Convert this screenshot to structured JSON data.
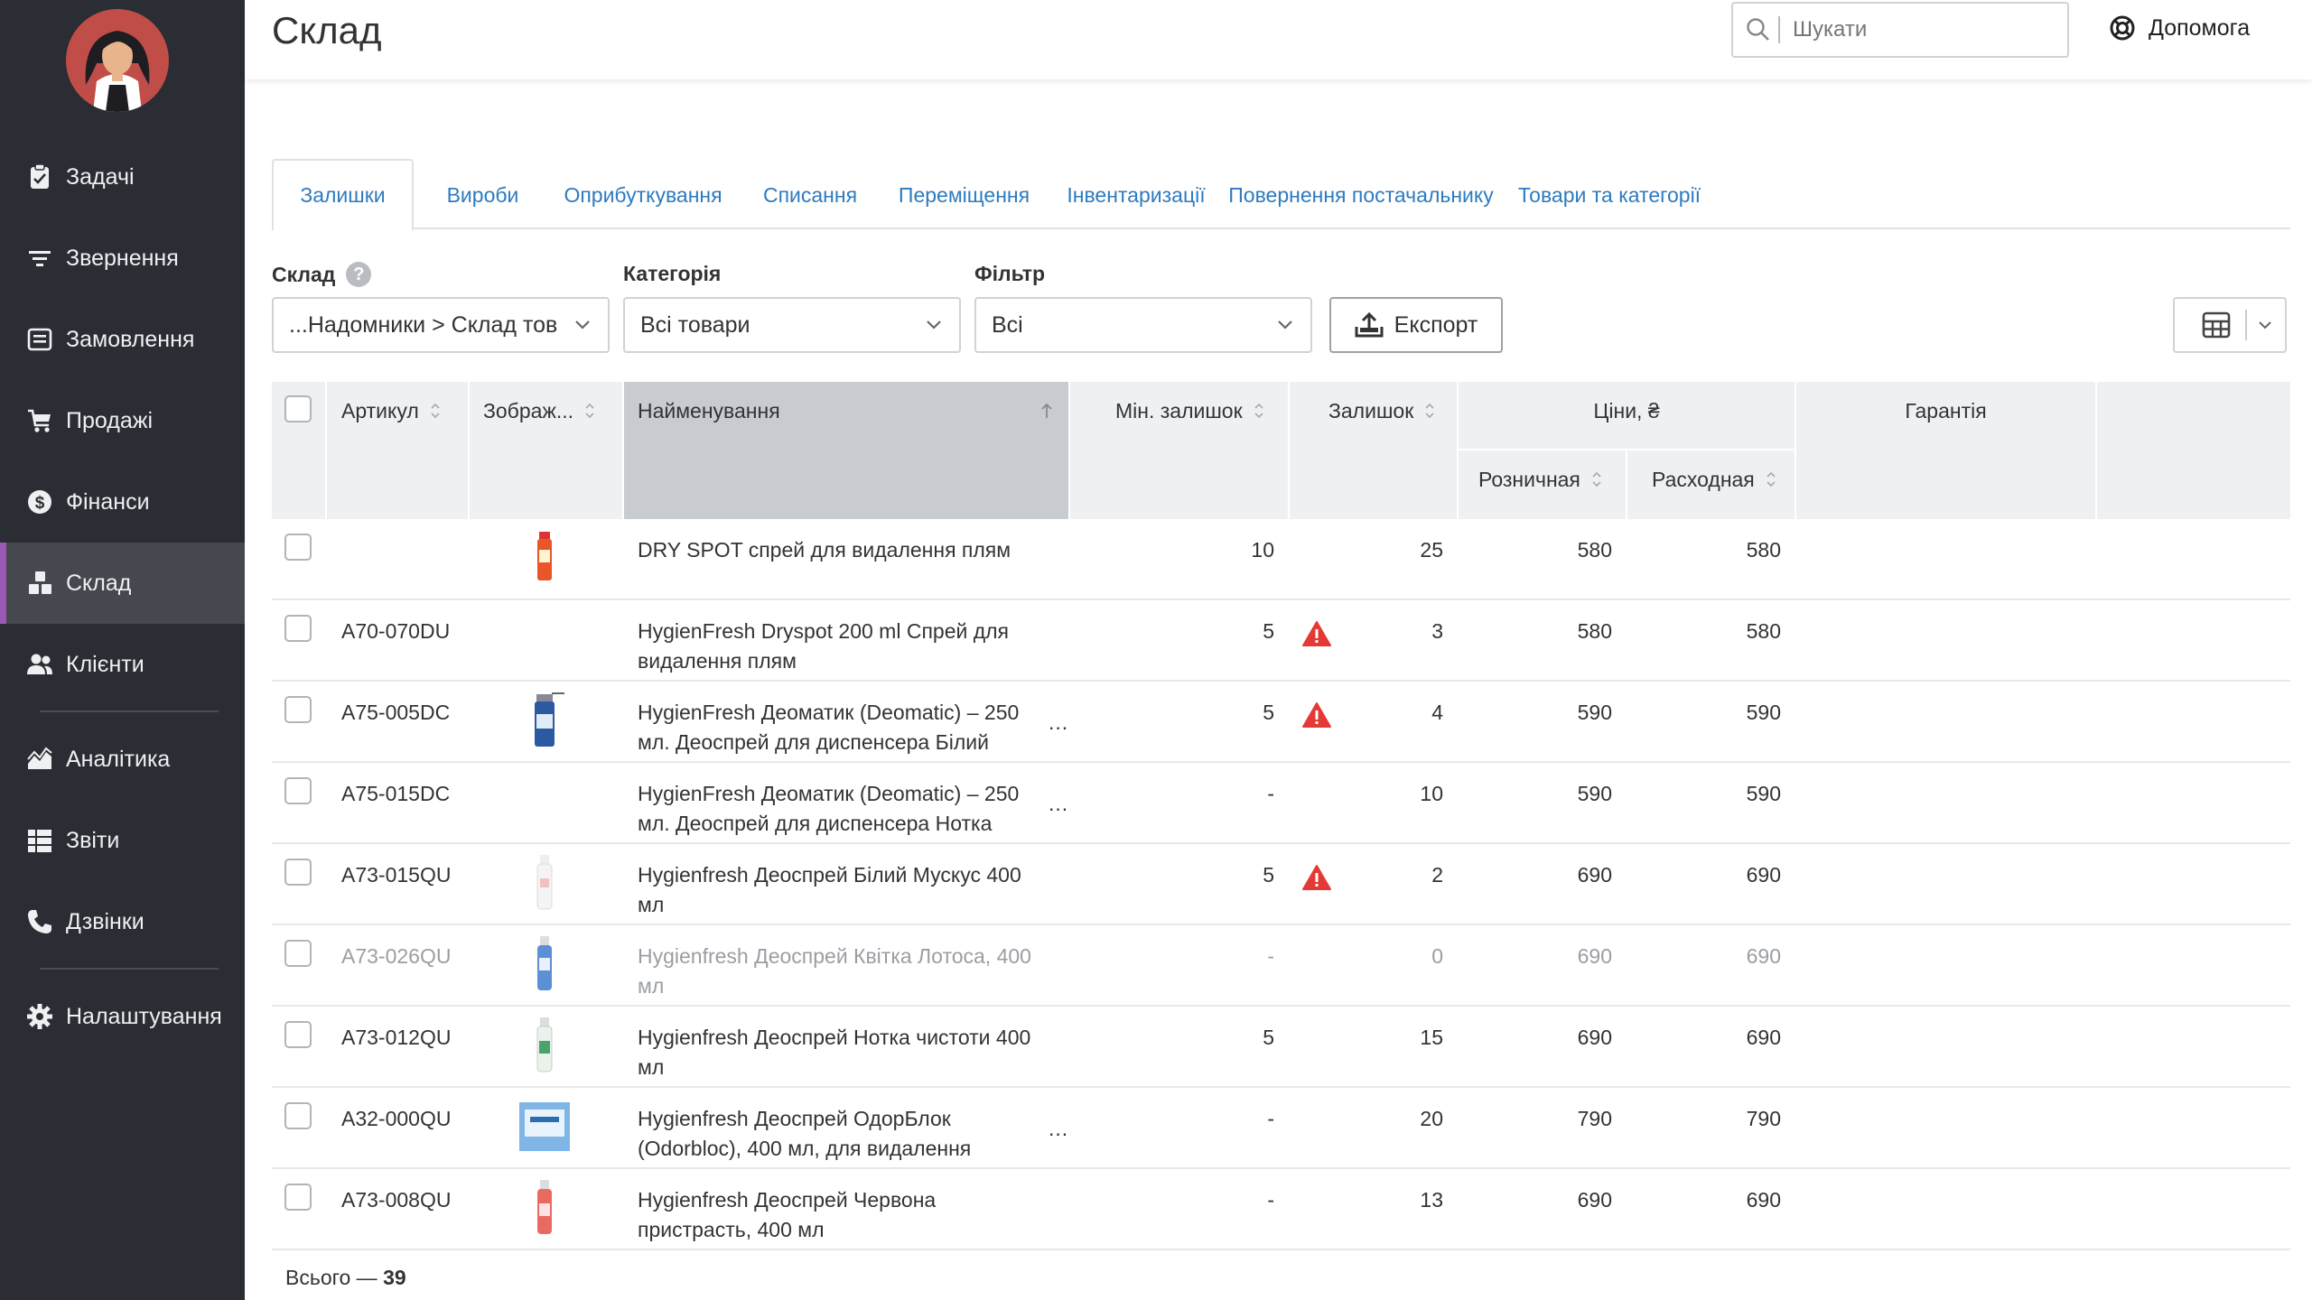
{
  "page": {
    "title": "Склад"
  },
  "search": {
    "placeholder": "Шукати"
  },
  "help": {
    "label": "Допомога"
  },
  "sidebar": {
    "items": [
      {
        "label": "Задачі",
        "icon": "clipboard-icon"
      },
      {
        "label": "Звернення",
        "icon": "filter-icon"
      },
      {
        "label": "Замовлення",
        "icon": "order-icon"
      },
      {
        "label": "Продажі",
        "icon": "cart-icon"
      },
      {
        "label": "Фінанси",
        "icon": "dollar-icon"
      },
      {
        "label": "Склад",
        "icon": "boxes-icon",
        "active": true
      },
      {
        "label": "Клієнти",
        "icon": "users-icon"
      },
      {
        "label": "Аналітика",
        "icon": "chart-icon"
      },
      {
        "label": "Звіти",
        "icon": "report-list-icon"
      },
      {
        "label": "Дзвінки",
        "icon": "phone-icon"
      },
      {
        "label": "Налаштування",
        "icon": "gear-icon"
      }
    ]
  },
  "tabs": [
    "Залишки",
    "Вироби",
    "Оприбуткування",
    "Списання",
    "Переміщення",
    "Інвентаризації",
    "Повернення постачальнику",
    "Товари та категорії"
  ],
  "filters": {
    "warehouse": {
      "label": "Склад",
      "value": "...Надомники > Склад тов"
    },
    "category": {
      "label": "Категорія",
      "value": "Всі товари"
    },
    "filter": {
      "label": "Фільтр",
      "value": "Всі"
    }
  },
  "export": {
    "label": "Експорт"
  },
  "table": {
    "columns": {
      "article": "Артикул",
      "image": "Зображ...",
      "name": "Найменування",
      "min_stock": "Мін. залишок",
      "stock": "Залишок",
      "prices": "Ціни, ₴",
      "retail": "Розничная",
      "expense": "Расходная",
      "warranty": "Гарантія"
    },
    "rows": [
      {
        "article": "",
        "name1": "DRY SPOT спрей для видалення плям",
        "name2": "",
        "min": "10",
        "stock": "25",
        "retail": "580",
        "expense": "580",
        "warn": false,
        "dim": false,
        "ellipsis": false,
        "thumb": "orange-spray"
      },
      {
        "article": "A70-070DU",
        "name1": "HygienFresh Dryspot 200 ml Спрей для",
        "name2": "видалення плям",
        "min": "5",
        "stock": "3",
        "retail": "580",
        "expense": "580",
        "warn": true,
        "dim": false,
        "ellipsis": false,
        "thumb": ""
      },
      {
        "article": "A75-005DC",
        "name1": "HygienFresh Деоматик (Deomatic) – 250",
        "name2": "мл. Деоспрей для диспенсера Білий",
        "min": "5",
        "stock": "4",
        "retail": "590",
        "expense": "590",
        "warn": true,
        "dim": false,
        "ellipsis": true,
        "thumb": "blue-can"
      },
      {
        "article": "A75-015DC",
        "name1": "HygienFresh Деоматик (Deomatic) – 250",
        "name2": "мл. Деоспрей для диспенсера Нотка",
        "min": "-",
        "stock": "10",
        "retail": "590",
        "expense": "590",
        "warn": false,
        "dim": false,
        "ellipsis": true,
        "thumb": ""
      },
      {
        "article": "A73-015QU",
        "name1": "Hygienfresh Деоспрей Білий Мускус 400",
        "name2": "мл",
        "min": "5",
        "stock": "2",
        "retail": "690",
        "expense": "690",
        "warn": true,
        "dim": false,
        "ellipsis": false,
        "thumb": "white-bottle"
      },
      {
        "article": "A73-026QU",
        "name1": "Hygienfresh Деоспрей Квітка Лотоса, 400",
        "name2": "мл",
        "min": "-",
        "stock": "0",
        "retail": "690",
        "expense": "690",
        "warn": false,
        "dim": true,
        "ellipsis": false,
        "thumb": "blue-bottle"
      },
      {
        "article": "A73-012QU",
        "name1": "Hygienfresh Деоспрей Нотка чистоти 400",
        "name2": "мл",
        "min": "5",
        "stock": "15",
        "retail": "690",
        "expense": "690",
        "warn": false,
        "dim": false,
        "ellipsis": false,
        "thumb": "green-bottle"
      },
      {
        "article": "A32-000QU",
        "name1": "Hygienfresh Деоспрей ОдорБлок",
        "name2": "(Odorbloc), 400 мл, для видалення",
        "min": "-",
        "stock": "20",
        "retail": "790",
        "expense": "790",
        "warn": false,
        "dim": false,
        "ellipsis": true,
        "thumb": "blue-box"
      },
      {
        "article": "A73-008QU",
        "name1": "Hygienfresh Деоспрей Червона",
        "name2": "пристрасть, 400 мл",
        "min": "-",
        "stock": "13",
        "retail": "690",
        "expense": "690",
        "warn": false,
        "dim": false,
        "ellipsis": false,
        "thumb": "red-bottle"
      }
    ]
  },
  "footer": {
    "total_label": "Всього —",
    "total_value": "39"
  },
  "colors": {
    "sidebar": "#2a2d34",
    "active_nav": "#45484f",
    "accent": "#9b59b6",
    "link": "#2e7bbf",
    "warning": "#e53935"
  }
}
